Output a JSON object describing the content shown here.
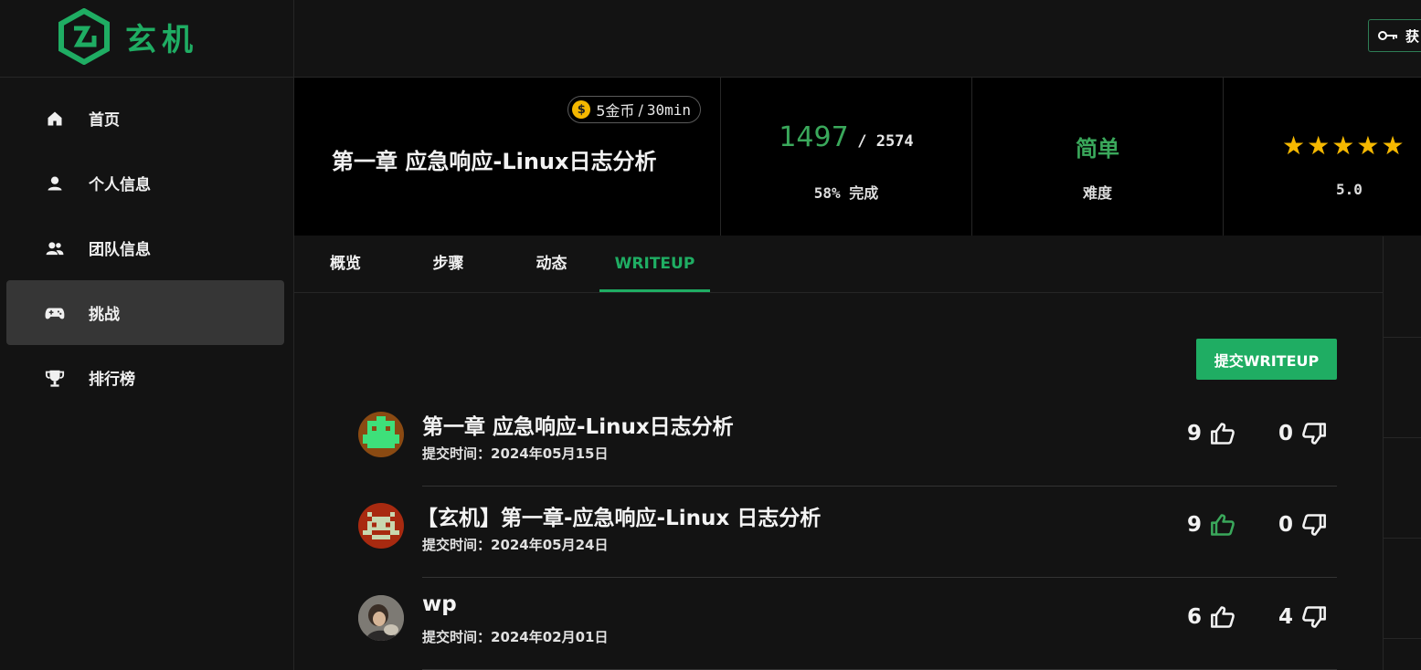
{
  "brand": {
    "name": "玄机",
    "color": "#1fad63"
  },
  "topbar": {
    "key_button_label": "获"
  },
  "sidebar": {
    "items": [
      {
        "label": "首页",
        "icon": "home-icon"
      },
      {
        "label": "个人信息",
        "icon": "user-icon"
      },
      {
        "label": "团队信息",
        "icon": "team-icon"
      },
      {
        "label": "挑战",
        "icon": "gamepad-icon",
        "active": true
      },
      {
        "label": "排行榜",
        "icon": "trophy-icon"
      }
    ]
  },
  "challenge": {
    "title": "第一章 应急响应-Linux日志分析",
    "coins": "5金币",
    "separator": "/",
    "duration": "30min",
    "solved": "1497",
    "total": "/ 2574",
    "completion": "58% 完成",
    "difficulty": "简单",
    "difficulty_label": "难度",
    "rating": "5.0",
    "rating_stars": 5
  },
  "tabs": [
    {
      "label": "概览"
    },
    {
      "label": "步骤"
    },
    {
      "label": "动态"
    },
    {
      "label": "WRITEUP",
      "active": true
    }
  ],
  "submit_button": "提交WRITEUP",
  "writeups": [
    {
      "title": "第一章 应急响应-Linux日志分析",
      "time": "提交时间：2024年05月15日",
      "likes": "9",
      "dislikes": "0",
      "liked": false
    },
    {
      "title": "【玄机】第一章-应急响应-Linux 日志分析",
      "time": "提交时间：2024年05月24日",
      "likes": "9",
      "dislikes": "0",
      "liked": true
    },
    {
      "title": "wp",
      "time": "提交时间：2024年02月01日",
      "likes": "6",
      "dislikes": "4",
      "liked": false
    }
  ],
  "colors": {
    "accent": "#1fad63",
    "stat_green": "#3aa85b",
    "star": "#f5b800",
    "background": "#131313",
    "header_bg": "#000000"
  }
}
